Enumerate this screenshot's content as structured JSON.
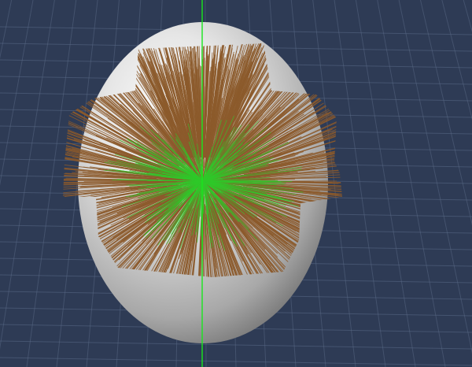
{
  "viewport": {
    "background_color": "#2e3b55",
    "grid_color": "#5a6a86",
    "axis_color": "#19e61e"
  },
  "model": {
    "object": "egg-shaped-head-mesh",
    "surface_color": "#d9d9d9",
    "hair_color": "#8c5a2b",
    "hair_guide_color": "#2fc82a"
  }
}
